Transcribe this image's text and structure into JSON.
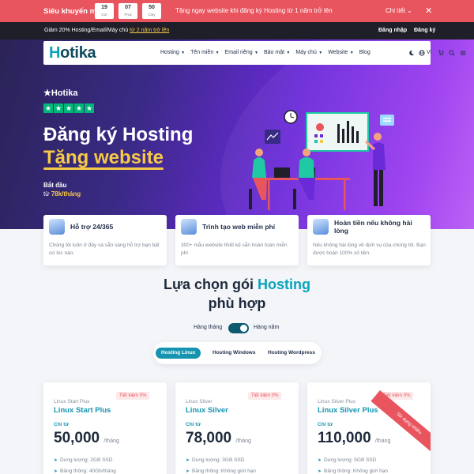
{
  "promo": {
    "title": "Siêu khuyến mại",
    "timer": [
      {
        "value": "19",
        "unit": "Giờ"
      },
      {
        "value": "07",
        "unit": "Phút"
      },
      {
        "value": "50",
        "unit": "Giây"
      }
    ],
    "message": "Tặng ngay website khi đăng ký Hosting từ 1 năm trở lên",
    "detail_label": "Chi tiết",
    "close_label": "✕"
  },
  "topbar": {
    "offer_text": "Giảm 20% Hosting/Email/Máy chủ",
    "offer_link": "từ 2 năm trở lên",
    "login_label": "Đăng nhập",
    "register_label": "Đăng ký"
  },
  "nav": {
    "logo_first": "H",
    "logo_rest": "otika",
    "items": [
      {
        "label": "Hosting",
        "dropdown": true
      },
      {
        "label": "Tên miền",
        "dropdown": true
      },
      {
        "label": "Email riêng",
        "dropdown": true
      },
      {
        "label": "Bảo mật",
        "dropdown": true
      },
      {
        "label": "Máy chủ",
        "dropdown": true
      },
      {
        "label": "Website",
        "dropdown": true
      },
      {
        "label": "Blog",
        "dropdown": false
      }
    ],
    "lang_label": "Vi",
    "icons": [
      "moon-icon",
      "globe-icon",
      "cart-icon",
      "search-icon",
      "menu-icon"
    ]
  },
  "hero": {
    "brand": "Hotika",
    "rating_stars": 5,
    "title": "Đăng ký Hosting",
    "subtitle": "Tặng website",
    "from_label": "Bắt đầu",
    "price_prefix": "từ",
    "price": "78k/tháng"
  },
  "features": [
    {
      "icon": "support-icon",
      "title": "Hỗ trợ 24/365",
      "desc": "Chúng tôi luôn ở đây và sẵn sàng hỗ trợ bạn bất cứ lúc nào."
    },
    {
      "icon": "website-icon",
      "title": "Trình tạo web miễn phí",
      "desc": "300+ mẫu website thiết kế sẵn hoàn toàn miễn phí"
    },
    {
      "icon": "refund-icon",
      "title": "Hoàn tiền nếu không hài lòng",
      "desc": "Nếu không hài lòng về dịch vụ của chúng tôi. Bạn được hoàn 100% số tiền."
    }
  ],
  "section": {
    "title_prefix": "Lựa chọn gói",
    "title_highlight": "Hosting",
    "title_line2": "phù hợp",
    "toggle_monthly": "Hàng tháng",
    "toggle_yearly": "Hàng năm"
  },
  "tabs": [
    "Hosting Linux",
    "Hosting Windows",
    "Hosting Wordpress"
  ],
  "plans": [
    {
      "pre": "Linux Start Plus",
      "name": "Linux Start Plus",
      "save": "Tiết kiệm 0%",
      "from": "Chỉ từ",
      "price": "50,000",
      "per": "/tháng",
      "storage": "Dung lượng: 2GB SSD",
      "bandwidth": "Băng thông: 40Gb/tháng",
      "ribbon": ""
    },
    {
      "pre": "Linux Silver",
      "name": "Linux Silver",
      "save": "Tiết kiệm 0%",
      "from": "Chỉ từ",
      "price": "78,000",
      "per": "/tháng",
      "storage": "Dung lượng: 3GB SSD",
      "bandwidth": "Băng thông: Không giới hạn",
      "ribbon": ""
    },
    {
      "pre": "Linux Silver Plus",
      "name": "Linux Silver Plus",
      "save": "Tiết kiệm 0%",
      "from": "Chỉ từ",
      "price": "110,000",
      "per": "/tháng",
      "storage": "Dung lượng: 5GB SSD",
      "bandwidth": "Băng thông: Không giới hạn",
      "ribbon": "Sử dụng nhiều"
    }
  ],
  "colors": {
    "promo": "#e9555f",
    "accent": "#1494b0",
    "highlight": "#f7c948",
    "trustpilot": "#00b67a"
  }
}
